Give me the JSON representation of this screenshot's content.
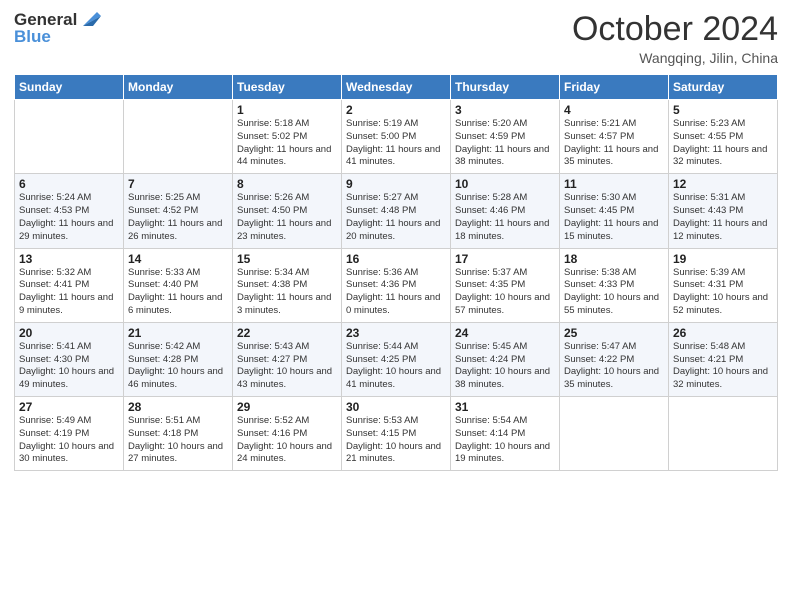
{
  "header": {
    "logo_line1": "General",
    "logo_line2": "Blue",
    "month": "October 2024",
    "location": "Wangqing, Jilin, China"
  },
  "days_of_week": [
    "Sunday",
    "Monday",
    "Tuesday",
    "Wednesday",
    "Thursday",
    "Friday",
    "Saturday"
  ],
  "weeks": [
    [
      {
        "day": "",
        "sunrise": "",
        "sunset": "",
        "daylight": ""
      },
      {
        "day": "",
        "sunrise": "",
        "sunset": "",
        "daylight": ""
      },
      {
        "day": "1",
        "sunrise": "Sunrise: 5:18 AM",
        "sunset": "Sunset: 5:02 PM",
        "daylight": "Daylight: 11 hours and 44 minutes."
      },
      {
        "day": "2",
        "sunrise": "Sunrise: 5:19 AM",
        "sunset": "Sunset: 5:00 PM",
        "daylight": "Daylight: 11 hours and 41 minutes."
      },
      {
        "day": "3",
        "sunrise": "Sunrise: 5:20 AM",
        "sunset": "Sunset: 4:59 PM",
        "daylight": "Daylight: 11 hours and 38 minutes."
      },
      {
        "day": "4",
        "sunrise": "Sunrise: 5:21 AM",
        "sunset": "Sunset: 4:57 PM",
        "daylight": "Daylight: 11 hours and 35 minutes."
      },
      {
        "day": "5",
        "sunrise": "Sunrise: 5:23 AM",
        "sunset": "Sunset: 4:55 PM",
        "daylight": "Daylight: 11 hours and 32 minutes."
      }
    ],
    [
      {
        "day": "6",
        "sunrise": "Sunrise: 5:24 AM",
        "sunset": "Sunset: 4:53 PM",
        "daylight": "Daylight: 11 hours and 29 minutes."
      },
      {
        "day": "7",
        "sunrise": "Sunrise: 5:25 AM",
        "sunset": "Sunset: 4:52 PM",
        "daylight": "Daylight: 11 hours and 26 minutes."
      },
      {
        "day": "8",
        "sunrise": "Sunrise: 5:26 AM",
        "sunset": "Sunset: 4:50 PM",
        "daylight": "Daylight: 11 hours and 23 minutes."
      },
      {
        "day": "9",
        "sunrise": "Sunrise: 5:27 AM",
        "sunset": "Sunset: 4:48 PM",
        "daylight": "Daylight: 11 hours and 20 minutes."
      },
      {
        "day": "10",
        "sunrise": "Sunrise: 5:28 AM",
        "sunset": "Sunset: 4:46 PM",
        "daylight": "Daylight: 11 hours and 18 minutes."
      },
      {
        "day": "11",
        "sunrise": "Sunrise: 5:30 AM",
        "sunset": "Sunset: 4:45 PM",
        "daylight": "Daylight: 11 hours and 15 minutes."
      },
      {
        "day": "12",
        "sunrise": "Sunrise: 5:31 AM",
        "sunset": "Sunset: 4:43 PM",
        "daylight": "Daylight: 11 hours and 12 minutes."
      }
    ],
    [
      {
        "day": "13",
        "sunrise": "Sunrise: 5:32 AM",
        "sunset": "Sunset: 4:41 PM",
        "daylight": "Daylight: 11 hours and 9 minutes."
      },
      {
        "day": "14",
        "sunrise": "Sunrise: 5:33 AM",
        "sunset": "Sunset: 4:40 PM",
        "daylight": "Daylight: 11 hours and 6 minutes."
      },
      {
        "day": "15",
        "sunrise": "Sunrise: 5:34 AM",
        "sunset": "Sunset: 4:38 PM",
        "daylight": "Daylight: 11 hours and 3 minutes."
      },
      {
        "day": "16",
        "sunrise": "Sunrise: 5:36 AM",
        "sunset": "Sunset: 4:36 PM",
        "daylight": "Daylight: 11 hours and 0 minutes."
      },
      {
        "day": "17",
        "sunrise": "Sunrise: 5:37 AM",
        "sunset": "Sunset: 4:35 PM",
        "daylight": "Daylight: 10 hours and 57 minutes."
      },
      {
        "day": "18",
        "sunrise": "Sunrise: 5:38 AM",
        "sunset": "Sunset: 4:33 PM",
        "daylight": "Daylight: 10 hours and 55 minutes."
      },
      {
        "day": "19",
        "sunrise": "Sunrise: 5:39 AM",
        "sunset": "Sunset: 4:31 PM",
        "daylight": "Daylight: 10 hours and 52 minutes."
      }
    ],
    [
      {
        "day": "20",
        "sunrise": "Sunrise: 5:41 AM",
        "sunset": "Sunset: 4:30 PM",
        "daylight": "Daylight: 10 hours and 49 minutes."
      },
      {
        "day": "21",
        "sunrise": "Sunrise: 5:42 AM",
        "sunset": "Sunset: 4:28 PM",
        "daylight": "Daylight: 10 hours and 46 minutes."
      },
      {
        "day": "22",
        "sunrise": "Sunrise: 5:43 AM",
        "sunset": "Sunset: 4:27 PM",
        "daylight": "Daylight: 10 hours and 43 minutes."
      },
      {
        "day": "23",
        "sunrise": "Sunrise: 5:44 AM",
        "sunset": "Sunset: 4:25 PM",
        "daylight": "Daylight: 10 hours and 41 minutes."
      },
      {
        "day": "24",
        "sunrise": "Sunrise: 5:45 AM",
        "sunset": "Sunset: 4:24 PM",
        "daylight": "Daylight: 10 hours and 38 minutes."
      },
      {
        "day": "25",
        "sunrise": "Sunrise: 5:47 AM",
        "sunset": "Sunset: 4:22 PM",
        "daylight": "Daylight: 10 hours and 35 minutes."
      },
      {
        "day": "26",
        "sunrise": "Sunrise: 5:48 AM",
        "sunset": "Sunset: 4:21 PM",
        "daylight": "Daylight: 10 hours and 32 minutes."
      }
    ],
    [
      {
        "day": "27",
        "sunrise": "Sunrise: 5:49 AM",
        "sunset": "Sunset: 4:19 PM",
        "daylight": "Daylight: 10 hours and 30 minutes."
      },
      {
        "day": "28",
        "sunrise": "Sunrise: 5:51 AM",
        "sunset": "Sunset: 4:18 PM",
        "daylight": "Daylight: 10 hours and 27 minutes."
      },
      {
        "day": "29",
        "sunrise": "Sunrise: 5:52 AM",
        "sunset": "Sunset: 4:16 PM",
        "daylight": "Daylight: 10 hours and 24 minutes."
      },
      {
        "day": "30",
        "sunrise": "Sunrise: 5:53 AM",
        "sunset": "Sunset: 4:15 PM",
        "daylight": "Daylight: 10 hours and 21 minutes."
      },
      {
        "day": "31",
        "sunrise": "Sunrise: 5:54 AM",
        "sunset": "Sunset: 4:14 PM",
        "daylight": "Daylight: 10 hours and 19 minutes."
      },
      {
        "day": "",
        "sunrise": "",
        "sunset": "",
        "daylight": ""
      },
      {
        "day": "",
        "sunrise": "",
        "sunset": "",
        "daylight": ""
      }
    ]
  ]
}
